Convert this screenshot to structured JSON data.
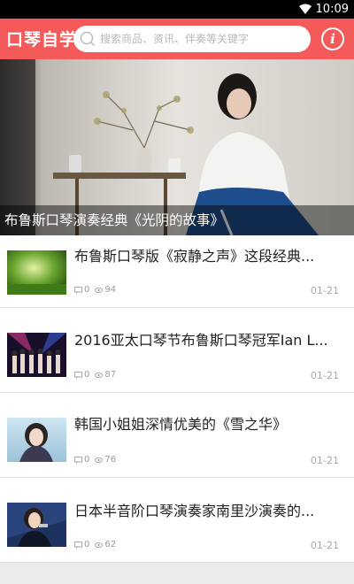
{
  "status": {
    "time": "10:09"
  },
  "header": {
    "brand": "口琴自学",
    "search_placeholder": "搜索商品、资讯、伴奏等关键字"
  },
  "banner": {
    "caption": "布鲁斯口琴演奏经典《光阴的故事》"
  },
  "articles": [
    {
      "title": "布鲁斯口琴版《寂静之声》这段经典...",
      "comments": "0",
      "views": "94",
      "date": "01-21"
    },
    {
      "title": "2016亚太口琴节布鲁斯口琴冠军Ian L...",
      "comments": "0",
      "views": "87",
      "date": "01-21"
    },
    {
      "title": "韩国小姐姐深情优美的《雪之华》",
      "comments": "0",
      "views": "76",
      "date": "01-21"
    },
    {
      "title": "日本半音阶口琴演奏家南里沙演奏的...",
      "comments": "0",
      "views": "62",
      "date": "01-21"
    }
  ]
}
